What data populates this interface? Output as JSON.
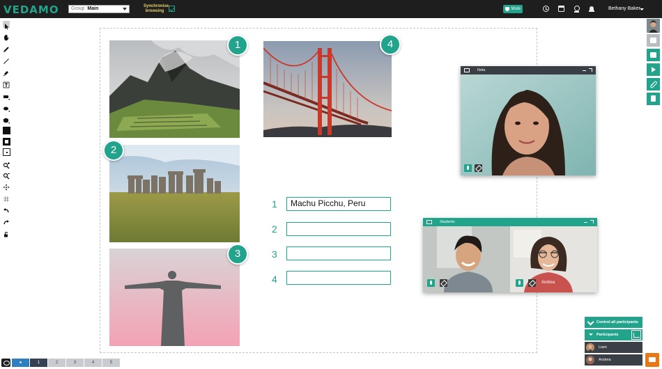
{
  "app": {
    "logo": "VEDAMO"
  },
  "header": {
    "group_label": "Group",
    "group_value": "Main",
    "sync_label": "Synchronise browsing",
    "mute_label": "Mute",
    "user_name": "Bethany Baker"
  },
  "toolbar": {
    "tools": [
      "pointer-icon",
      "hand-icon",
      "pen-icon",
      "line-icon",
      "highlighter-icon",
      "text-icon",
      "rectangle-icon",
      "ellipse-icon",
      "cube-icon",
      "fill-color-icon",
      "stroke-color-icon",
      "size-icon",
      "zoom-in-icon",
      "zoom-out-icon",
      "move-icon",
      "grid-icon",
      "undo-icon",
      "redo-icon",
      "lock-icon"
    ]
  },
  "board": {
    "badges": [
      "1",
      "2",
      "3",
      "4"
    ],
    "questions": [
      {
        "num": "1",
        "answer": "Machu Picchu, Peru"
      },
      {
        "num": "2",
        "answer": ""
      },
      {
        "num": "3",
        "answer": ""
      },
      {
        "num": "4",
        "answer": ""
      }
    ]
  },
  "video": {
    "teacher_title": "Nola",
    "students_title": "Students",
    "student_left_name": "",
    "student_right_name": "Andrea"
  },
  "participants": {
    "control_label": "Control all participants",
    "header_label": "Participants",
    "list": [
      "Liam",
      "Andrea"
    ]
  },
  "pager": {
    "first": "●",
    "pages": [
      "1",
      "2",
      "3",
      "4",
      "5"
    ],
    "current": "1"
  },
  "colors": {
    "accent": "#22a48c",
    "topbar": "#1e1e1e",
    "chat": "#e57917"
  }
}
